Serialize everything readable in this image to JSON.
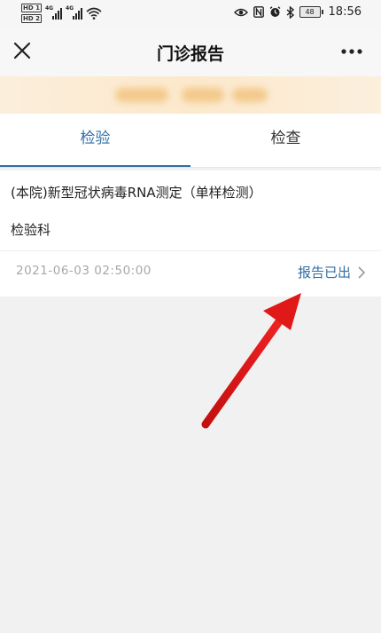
{
  "status_bar": {
    "sim1_badge": "HD 1",
    "sim2_badge": "HD 2",
    "sim1_network": "4G",
    "sim2_network": "4G",
    "battery": "48",
    "time": "18:56",
    "icons": [
      "eye-icon",
      "nfc-icon",
      "alarm-icon",
      "bluetooth-icon"
    ]
  },
  "nav": {
    "title": "门诊报告",
    "close_icon": "close-icon",
    "more_icon": "more-icon"
  },
  "tabs": [
    {
      "label": "检验",
      "active": true
    },
    {
      "label": "检查",
      "active": false
    }
  ],
  "report": {
    "title": "(本院)新型冠状病毒RNA测定（单样检测）",
    "department": "检验科",
    "datetime": "2021-06-03  02:50:00",
    "status": "报告已出"
  },
  "colors": {
    "accent": "#2f6ea6",
    "annotation_arrow": "#e01818"
  }
}
